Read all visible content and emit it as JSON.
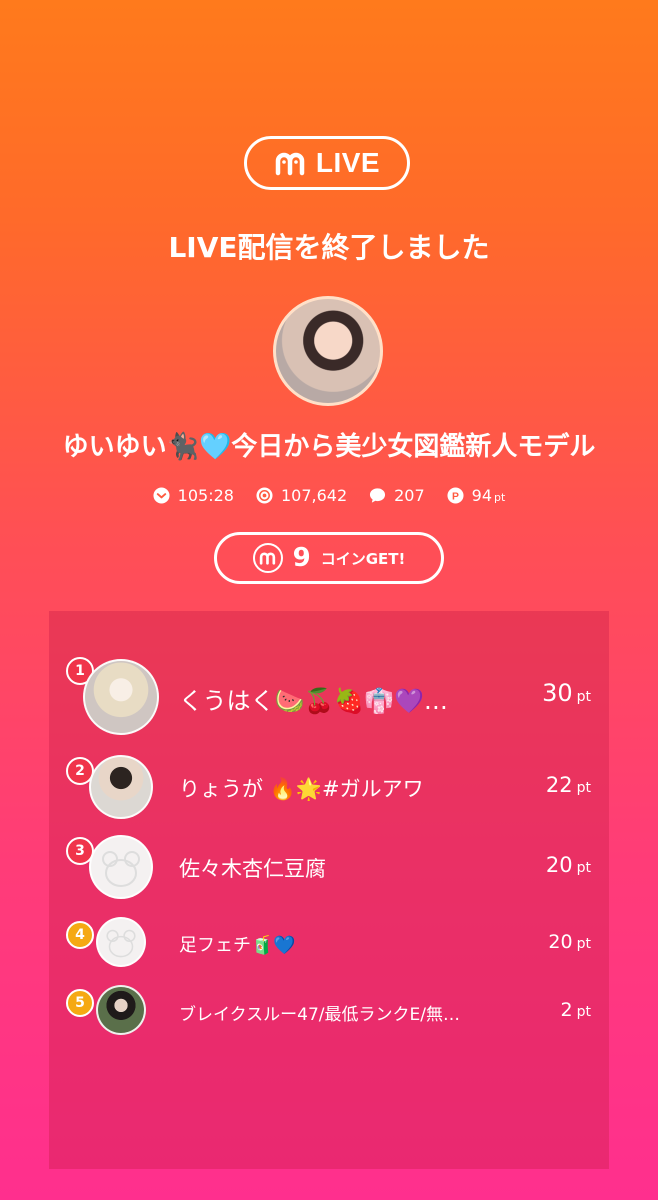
{
  "header": {
    "brand_label": "LIVE"
  },
  "title": "LIVE配信を終了しました",
  "streamer": {
    "name": "ゆいゆい🐈‍⬛🩵今日から美少女図鑑新人モデル"
  },
  "stats": {
    "duration": "105:28",
    "views": "107,642",
    "comments": "207",
    "points": "94",
    "points_unit": "pt"
  },
  "coins": {
    "count": "9",
    "label": "コインGET!"
  },
  "ranking": [
    {
      "rank": "1",
      "name": "くうはく🍉🍒🍓👘💜…",
      "points": "30",
      "unit": "pt"
    },
    {
      "rank": "2",
      "name": "りょうが 🔥🌟#ガルアワ",
      "points": "22",
      "unit": "pt"
    },
    {
      "rank": "3",
      "name": "佐々木杏仁豆腐",
      "points": "20",
      "unit": "pt"
    },
    {
      "rank": "4",
      "name": "足フェチ🧃💙",
      "points": "20",
      "unit": "pt"
    },
    {
      "rank": "5",
      "name": "ブレイクスルー47/最低ランクE/無…",
      "points": "2",
      "unit": "pt"
    }
  ],
  "colors": {
    "gradient_top": "#ff7a1c",
    "gradient_bottom": "#ff2f8e",
    "badge_red": "#f0344a",
    "badge_gold": "#f5a913"
  }
}
